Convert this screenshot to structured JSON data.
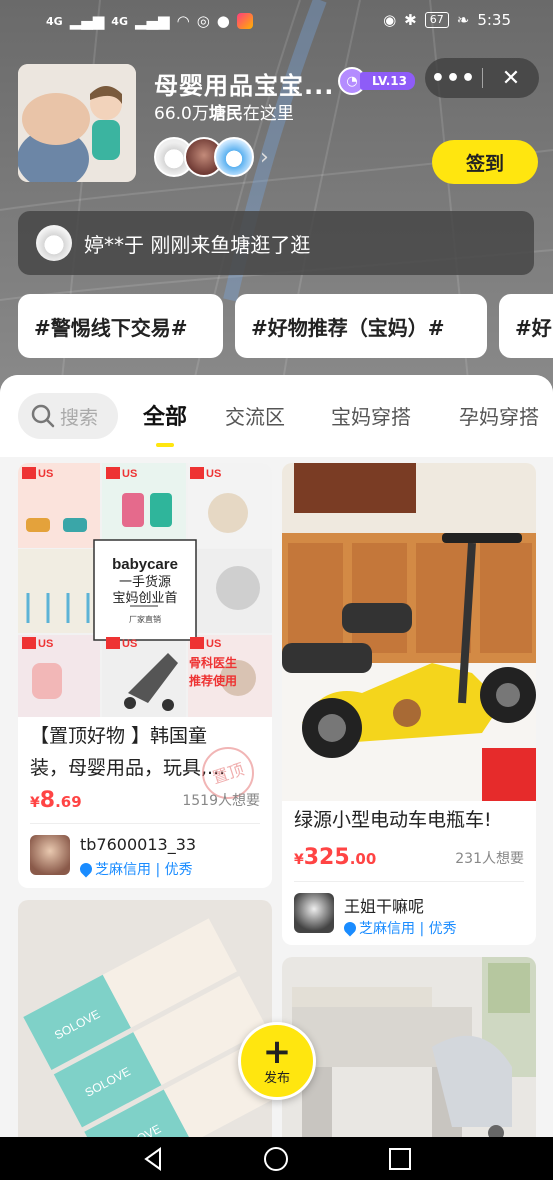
{
  "status_bar": {
    "signal1": "4G",
    "signal2": "4G",
    "battery": "67",
    "time": "5:35"
  },
  "group": {
    "title": "母婴用品宝宝...",
    "level": "LV.13",
    "member_count": "66.0万",
    "member_word": "塘民",
    "member_suffix": "在这里",
    "more_icon": "more-dots-icon",
    "close_icon": "close-icon",
    "checkin_label": "签到"
  },
  "notice": {
    "text": "婷**于 刚刚来鱼塘逛了逛"
  },
  "tags": [
    "#警惕线下交易#",
    "#好物推荐（宝妈）#",
    "#好"
  ],
  "search": {
    "placeholder": "搜索"
  },
  "tabs": [
    "全部",
    "交流区",
    "宝妈穿搭",
    "孕妈穿搭"
  ],
  "left_cards": [
    {
      "image_texts": [
        "babycare",
        "一手货源",
        "宝妈创业首",
        "厂家直销",
        "US",
        "US",
        "US",
        "US",
        "US",
        "US",
        "骨科医生",
        "推荐使用"
      ],
      "title_line1": "【置顶好物 】韩国童",
      "title_line2": "装，母婴用品，玩具,...",
      "stamp": "置顶",
      "price_currency": "¥",
      "price_int": "8",
      "price_dec": ".69",
      "wants": "1519人想要",
      "seller": "tb7600013_33",
      "credit": "芝麻信用 | 优秀"
    },
    {
      "image_texts": [
        "SOLOVE",
        "SOLOVE",
        "SOLOVE"
      ]
    }
  ],
  "right_cards": [
    {
      "title": "绿源小型电动车电瓶车!",
      "price_currency": "¥",
      "price_int": "325",
      "price_dec": ".00",
      "wants": "231人想要",
      "seller": "王姐干嘛呢",
      "credit": "芝麻信用 | 优秀"
    },
    {}
  ],
  "fab": {
    "label": "发布"
  },
  "colors": {
    "accent_yellow": "#ffe60f",
    "price_red": "#ff4444",
    "credit_blue": "#1a8cff",
    "level_purple": "#8e5cf7"
  }
}
